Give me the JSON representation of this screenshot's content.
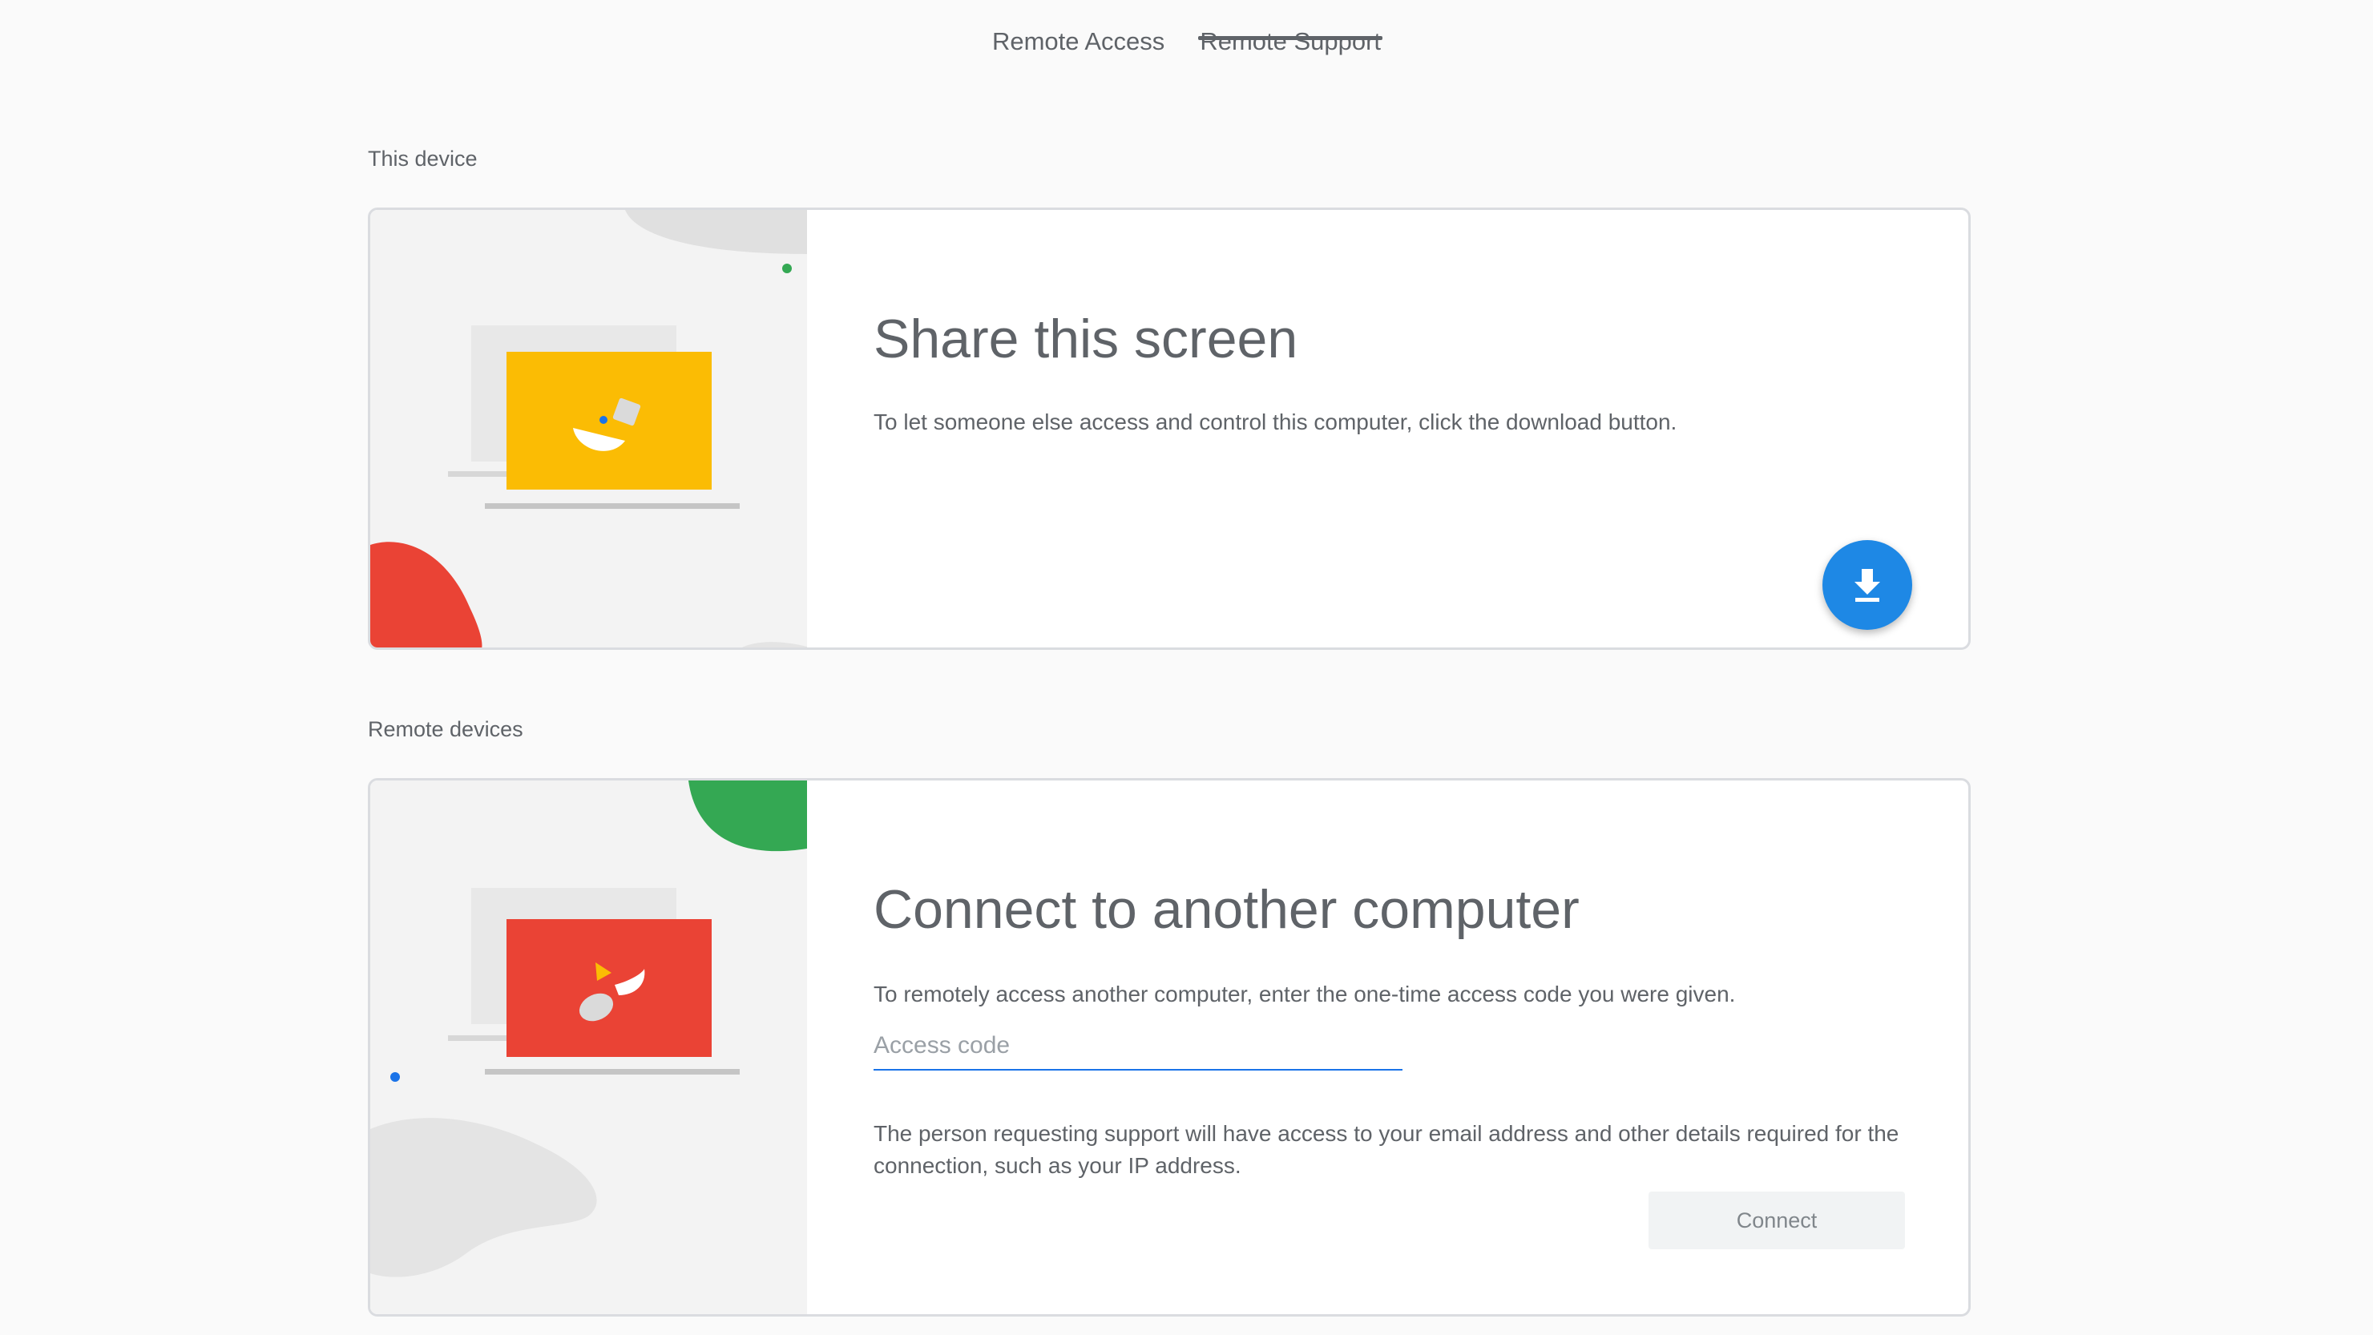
{
  "tabs": [
    {
      "label": "Remote Access",
      "active": false
    },
    {
      "label": "Remote Support",
      "active": true
    }
  ],
  "this_device": {
    "section_label": "This device",
    "title": "Share this screen",
    "description": "To let someone else access and control this computer, click the download button.",
    "download_icon": "download-icon",
    "download_color": "#1e88e5"
  },
  "remote_devices": {
    "section_label": "Remote devices",
    "title": "Connect to another computer",
    "description": "To remotely access another computer, enter the one-time access code you were given.",
    "access_code_placeholder": "Access code",
    "access_code_value": "",
    "notice": "The person requesting support will have access to your email address and other details required for the connection, such as your IP address.",
    "connect_label": "Connect"
  },
  "colors": {
    "yellow": "#fbbc04",
    "red": "#ea4335",
    "green": "#34a853",
    "blue": "#1e88e5",
    "accent_line": "#1a73e8"
  }
}
